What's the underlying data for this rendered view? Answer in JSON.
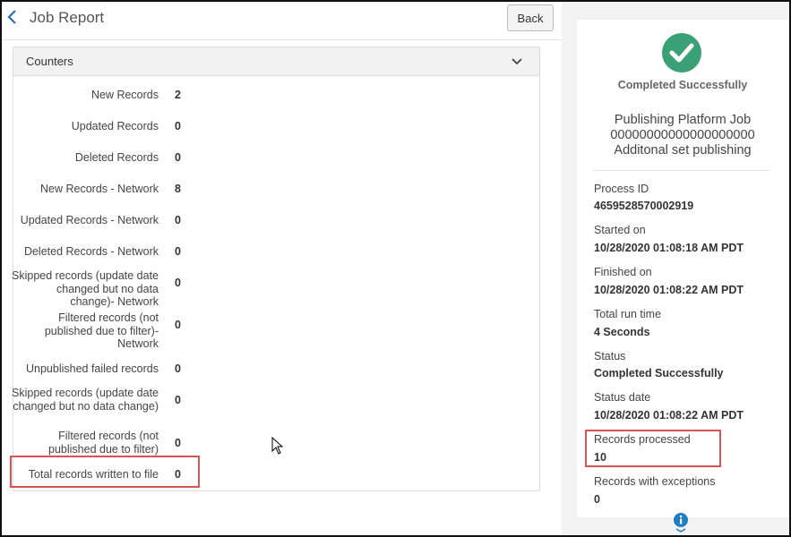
{
  "header": {
    "title": "Job Report",
    "back_label": "Back"
  },
  "counters": {
    "title": "Counters",
    "rows": [
      {
        "label": "New Records",
        "value": "2"
      },
      {
        "label": "Updated Records",
        "value": "0"
      },
      {
        "label": "Deleted Records",
        "value": "0"
      },
      {
        "label": "New Records - Network",
        "value": "8"
      },
      {
        "label": "Updated Records - Network",
        "value": "0"
      },
      {
        "label": "Deleted Records - Network",
        "value": "0"
      },
      {
        "label": "Skipped records (update date changed but no data change)- Network",
        "value": "0"
      },
      {
        "label": "Filtered records (not published due to filter)- Network",
        "value": "0"
      },
      {
        "label": "Unpublished failed records",
        "value": "0"
      },
      {
        "label": "Skipped records (update date changed but no data change)",
        "value": "0"
      },
      {
        "label": "Filtered records (not published due to filter)",
        "value": "0"
      },
      {
        "label": "Total records written to file",
        "value": "0"
      }
    ]
  },
  "summary": {
    "status_title": "Completed Successfully",
    "job_name_line1": "Publishing Platform Job",
    "job_name_line2": "00000000000000000000",
    "job_name_line3": "Additonal set publishing",
    "fields": [
      {
        "label": "Process ID",
        "value": "4659528570002919"
      },
      {
        "label": "Started on",
        "value": "10/28/2020 01:08:18 AM PDT"
      },
      {
        "label": "Finished on",
        "value": "10/28/2020 01:08:22 AM PDT"
      },
      {
        "label": "Total run time",
        "value": "4 Seconds"
      },
      {
        "label": "Status",
        "value": "Completed Successfully"
      },
      {
        "label": "Status date",
        "value": "10/28/2020 01:08:22 AM PDT"
      },
      {
        "label": "Records processed",
        "value": "10"
      },
      {
        "label": "Records with exceptions",
        "value": "0"
      }
    ]
  },
  "colors": {
    "success": "#3aa076",
    "highlight": "#d9534f",
    "info": "#1f7fc1"
  }
}
